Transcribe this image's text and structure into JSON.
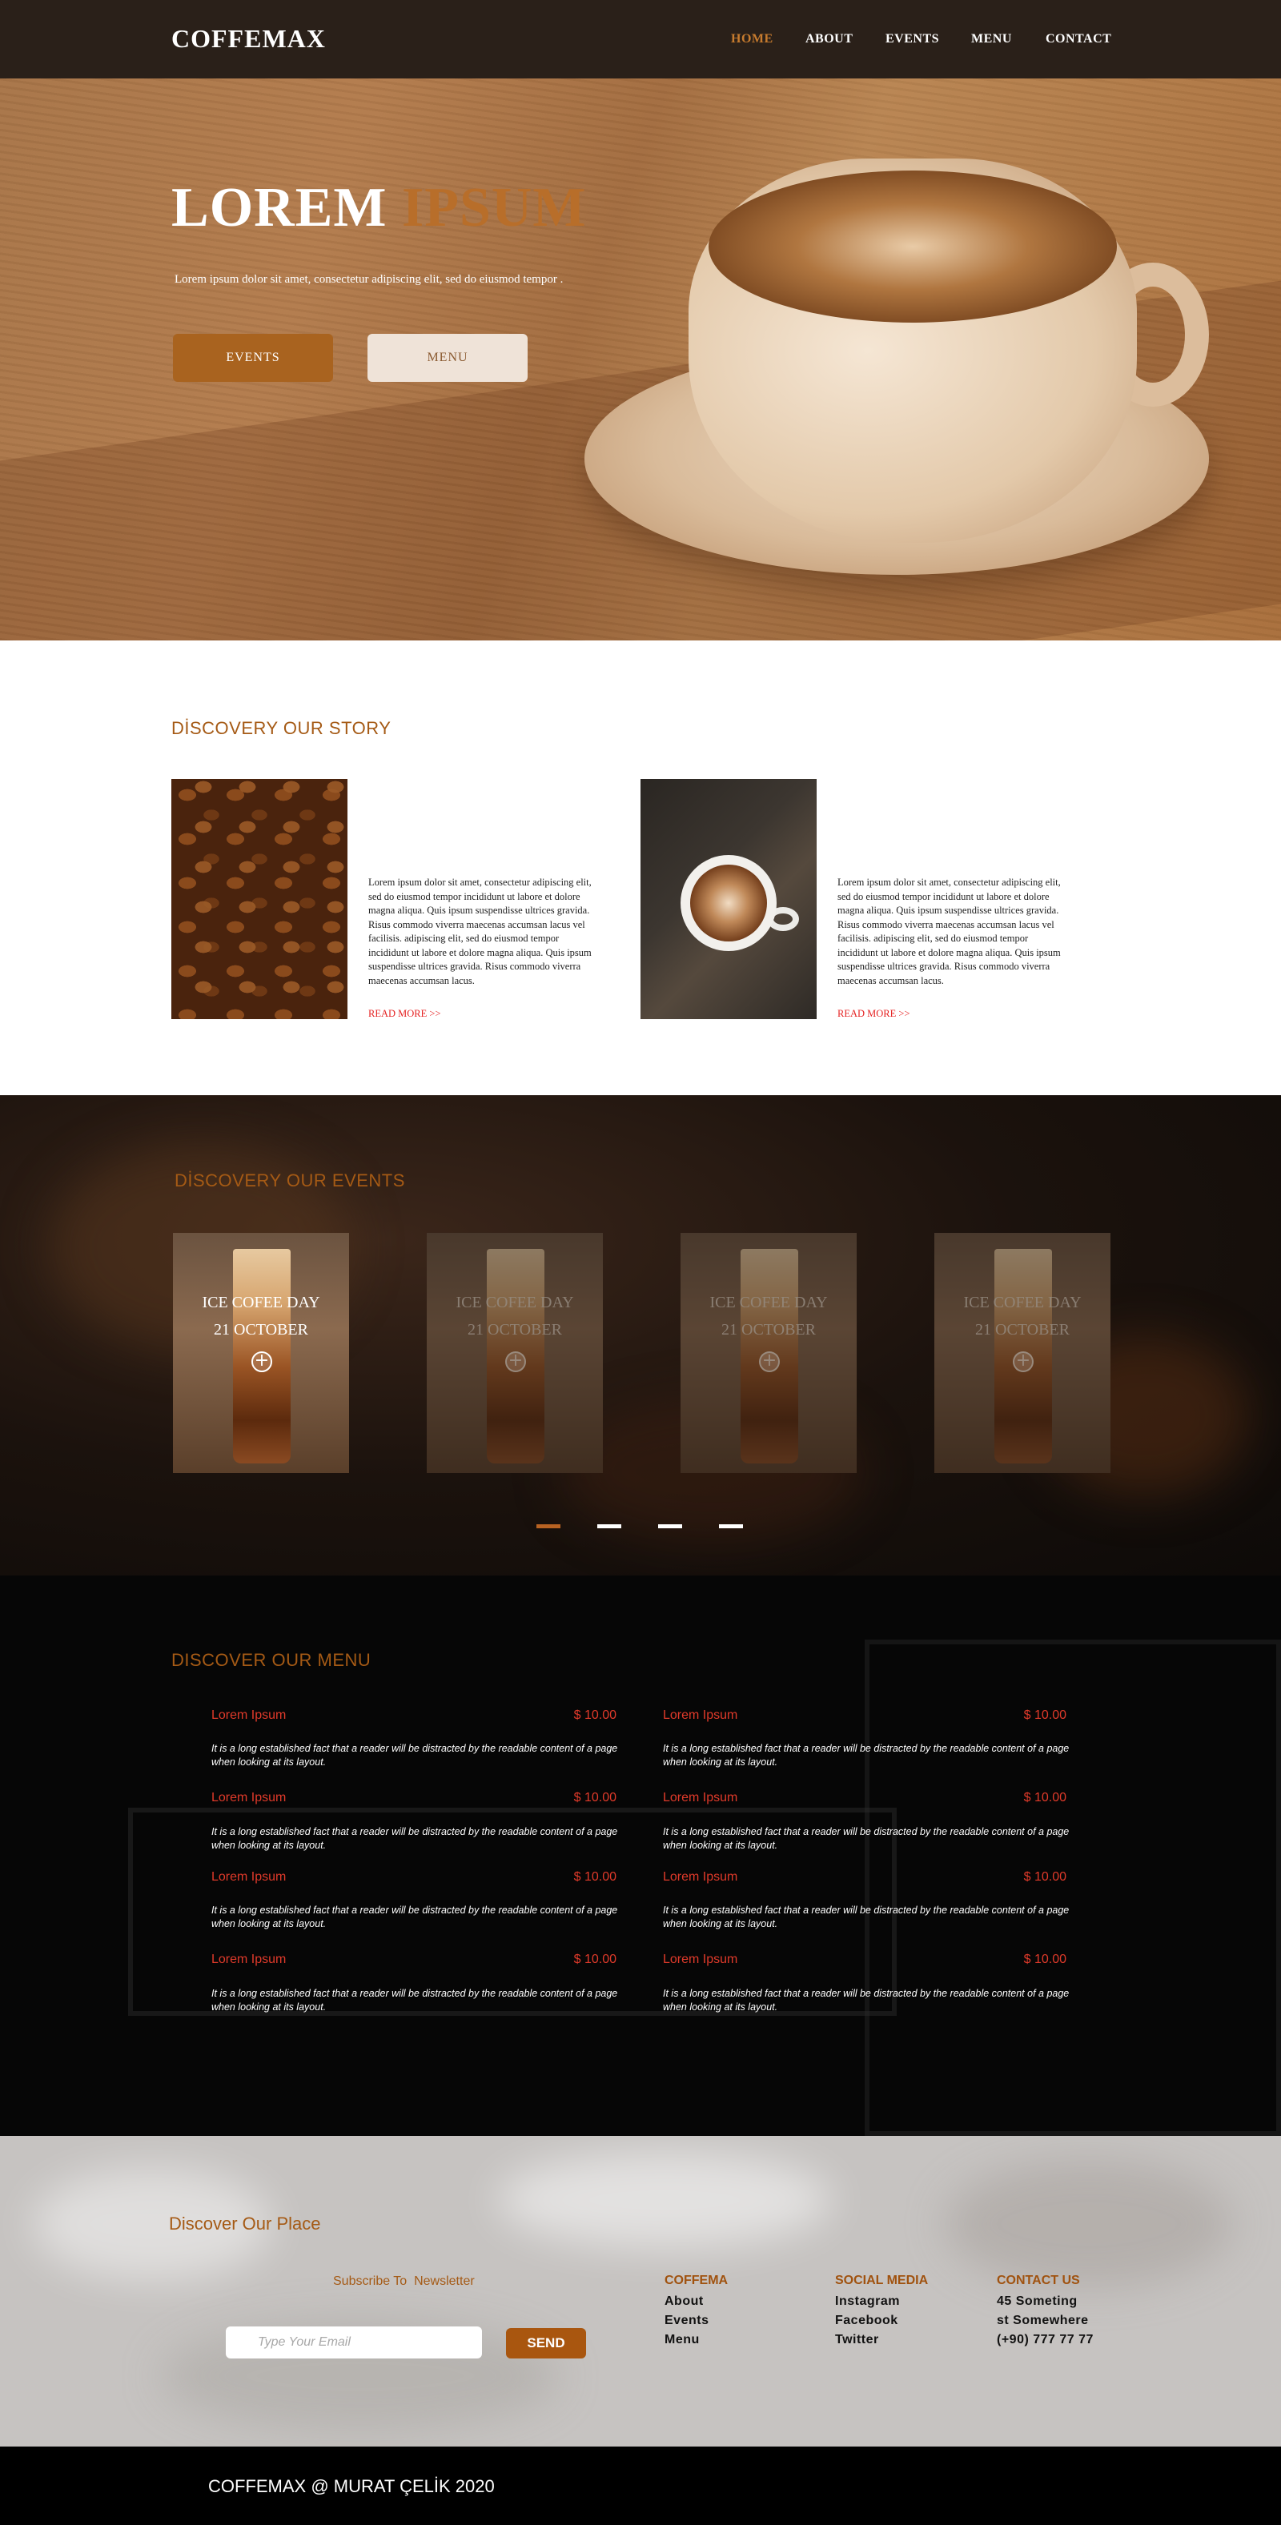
{
  "brand": {
    "logo": "COFFEMAX"
  },
  "nav": {
    "items": [
      {
        "label": "HOME",
        "active": true
      },
      {
        "label": "ABOUT"
      },
      {
        "label": "EVENTS"
      },
      {
        "label": "MENU"
      },
      {
        "label": "CONTACT"
      }
    ]
  },
  "hero": {
    "title_main": "LOREM",
    "title_accent": "IPSUM",
    "subtitle": "Lorem ipsum dolor sit amet, consectetur adipiscing elit, sed do eiusmod tempor .",
    "buttons": {
      "events": "EVENTS",
      "menu": "MENU"
    }
  },
  "story": {
    "title": "DİSCOVERY OUR STORY",
    "items": [
      {
        "text": "Lorem ipsum dolor sit amet, consectetur adipiscing elit, sed do eiusmod tempor incididunt ut labore et dolore magna aliqua. Quis ipsum suspendisse ultrices gravida. Risus commodo viverra maecenas accumsan lacus vel facilisis. adipiscing elit, sed do eiusmod tempor incididunt ut labore et dolore magna aliqua. Quis ipsum suspendisse ultrices gravida. Risus commodo viverra maecenas accumsan lacus.",
        "link": "READ MORE >>"
      },
      {
        "text": "Lorem ipsum dolor sit amet, consectetur adipiscing elit, sed do eiusmod tempor incididunt ut labore et dolore magna aliqua. Quis ipsum suspendisse ultrices gravida. Risus commodo viverra maecenas accumsan lacus vel facilisis. adipiscing elit, sed do eiusmod tempor incididunt ut labore et dolore magna aliqua. Quis ipsum suspendisse ultrices gravida. Risus commodo viverra maecenas accumsan lacus.",
        "link": "READ MORE >>"
      }
    ]
  },
  "events": {
    "title": "DİSCOVERY OUR EVENTS",
    "cards": [
      {
        "name": "ICE COFEE DAY",
        "date": "21 OCTOBER"
      },
      {
        "name": "ICE COFEE DAY",
        "date": "21 OCTOBER"
      },
      {
        "name": "ICE COFEE DAY",
        "date": "21 OCTOBER"
      },
      {
        "name": "ICE COFEE DAY",
        "date": "21 OCTOBER"
      }
    ],
    "active_slide": 1,
    "slide_count": 4
  },
  "menu": {
    "title": "DISCOVER OUR MENU",
    "items": [
      {
        "name": "Lorem Ipsum",
        "price": "$ 10.00",
        "desc": "It is a long established fact that a reader will be distracted by the readable content of a page when looking at its layout."
      },
      {
        "name": "Lorem Ipsum",
        "price": "$ 10.00",
        "desc": "It is a long established fact that a reader will be distracted by the readable content of a page when looking at its layout."
      },
      {
        "name": "Lorem Ipsum",
        "price": "$ 10.00",
        "desc": "It is a long established fact that a reader will be distracted by the readable content of a page when looking at its layout."
      },
      {
        "name": "Lorem Ipsum",
        "price": "$ 10.00",
        "desc": "It is a long established fact that a reader will be distracted by the readable content of a page when looking at its layout."
      },
      {
        "name": "Lorem Ipsum",
        "price": "$ 10.00",
        "desc": "It is a long established fact that a reader will be distracted by the readable content of a page when looking at its layout."
      },
      {
        "name": "Lorem Ipsum",
        "price": "$ 10.00",
        "desc": "It is a long established fact that a reader will be distracted by the readable content of a page when looking at its layout."
      },
      {
        "name": "Lorem Ipsum",
        "price": "$ 10.00",
        "desc": "It is a long established fact that a reader will be distracted by the readable content of a page when looking at its layout."
      },
      {
        "name": "Lorem Ipsum",
        "price": "$ 10.00",
        "desc": "It is a long established fact that a reader will be distracted by the readable content of a page when looking at its layout."
      }
    ]
  },
  "place": {
    "title": "Discover Our Place",
    "newsletter_label": "Subscribe To  Newsletter",
    "email_placeholder": "Type Your Email",
    "send_label": "SEND",
    "columns": [
      {
        "heading": "COFFEMA",
        "lines": [
          "About",
          "Events",
          "Menu"
        ]
      },
      {
        "heading": "SOCIAL MEDIA",
        "lines": [
          "Instagram",
          "Facebook",
          "Twitter"
        ]
      },
      {
        "heading": "CONTACT US",
        "lines": [
          "45 Someting",
          "st Somewhere",
          "(+90) 777 77 77"
        ]
      }
    ]
  },
  "footer": {
    "copyright": "COFFEMAX @  MURAT  ÇELİK 2020"
  },
  "colors": {
    "accent": "#a9631f",
    "nav_bg": "#2a2019",
    "menu_price": "#e03a2a",
    "read_more": "#e52222"
  }
}
